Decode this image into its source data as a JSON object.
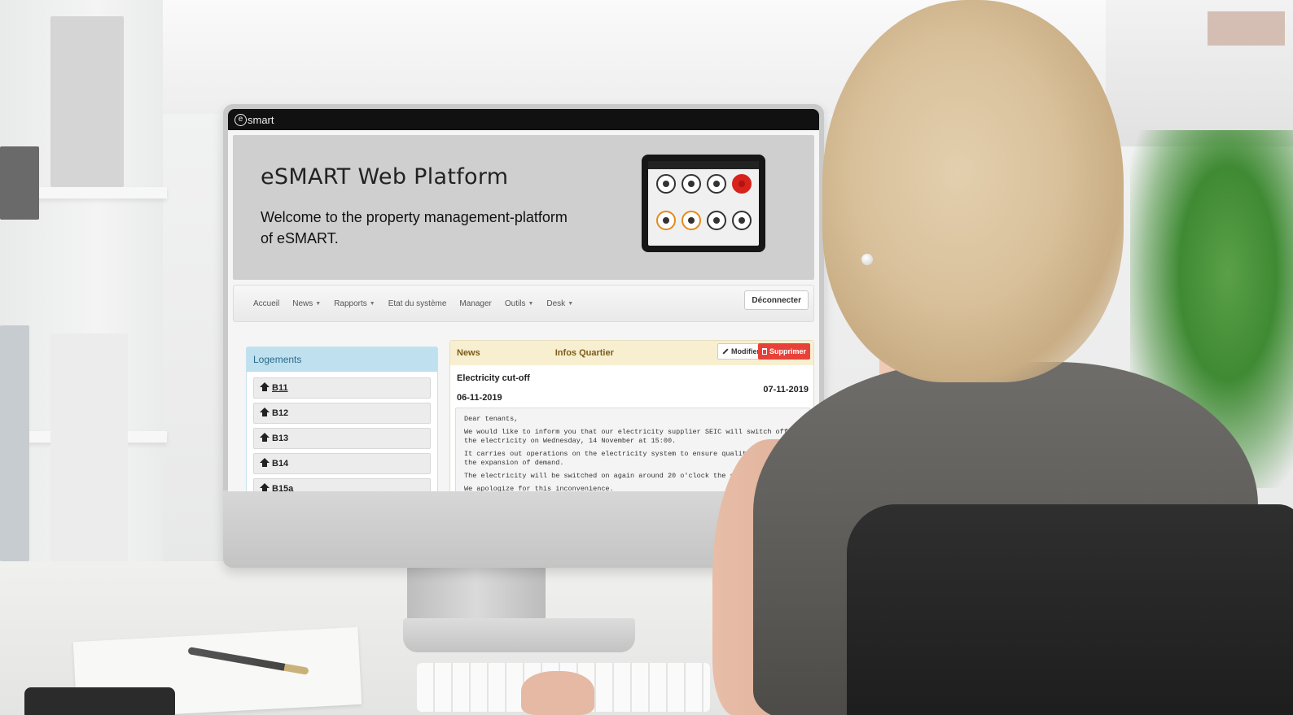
{
  "app": {
    "brand_mark": "e",
    "brand_name": "smart"
  },
  "hero": {
    "title": "eSMART Web Platform",
    "welcome": "Welcome to the property management-platform of eSMART."
  },
  "nav": {
    "items": [
      {
        "label": "Accueil",
        "caret": false
      },
      {
        "label": "News",
        "caret": true
      },
      {
        "label": "Rapports",
        "caret": true
      },
      {
        "label": "Etat du système",
        "caret": false
      },
      {
        "label": "Manager",
        "caret": false
      },
      {
        "label": "Outils",
        "caret": true
      },
      {
        "label": "Desk",
        "caret": true
      }
    ],
    "disconnect_label": "Déconnecter"
  },
  "logements": {
    "header": "Logements",
    "items": [
      "B11",
      "B12",
      "B13",
      "B14",
      "B15a"
    ],
    "active_item": "B11"
  },
  "news": {
    "tab_label": "News",
    "section_label": "Infos Quartier",
    "edit_label": "Modifier",
    "delete_label": "Supprimer",
    "title": "Electricity cut-off",
    "date_published": "07-11-2019",
    "date_event": "06-11-2019",
    "body": [
      "Dear tenants,",
      "We would like to inform you that our electricity supplier SEIC will switch off the electricity on Wednesday, 14 November at 15:00.",
      "It carries out operations on the electricity system to ensure quality and meet the expansion of demand.",
      "The electricity will be switched on again around 20 o'clock the same evening.",
      "We apologize for this inconvenience."
    ]
  },
  "colors": {
    "topbar": "#111111",
    "jumbotron": "#cfcfcf",
    "logements_header": "#bfe0ef",
    "news_header": "#f7efcf",
    "delete_button": "#e8413a"
  }
}
